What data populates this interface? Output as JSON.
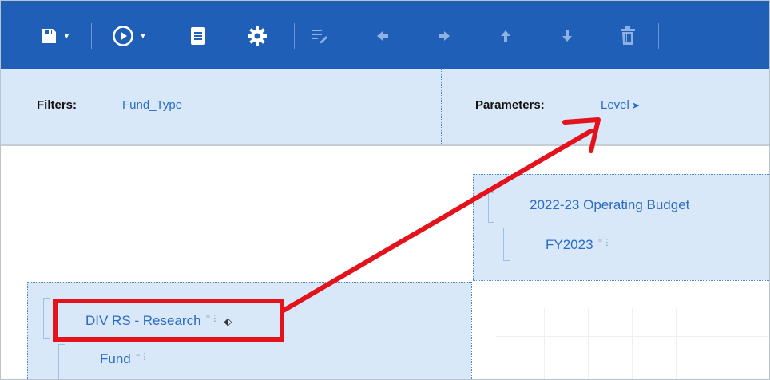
{
  "toolbar": {
    "icons": [
      "save-icon",
      "run-icon",
      "report-icon",
      "settings-icon",
      "edit-icon",
      "arrow-left-icon",
      "arrow-right-icon",
      "arrow-up-icon",
      "arrow-down-icon",
      "trash-icon"
    ]
  },
  "filters": {
    "filters_label": "Filters:",
    "filters_value": "Fund_Type",
    "parameters_label": "Parameters:",
    "parameters_value": "Level"
  },
  "columns": {
    "budget_title": "2022-23 Operating Budget",
    "fiscal_year": "FY2023"
  },
  "rows": {
    "division": "DIV RS - Research",
    "fund": "Fund"
  },
  "colors": {
    "toolbar_bg": "#1f5fb8",
    "panel_bg": "#d9e8f8",
    "link_text": "#2a6cc5",
    "annotation_red": "#e3121b"
  }
}
